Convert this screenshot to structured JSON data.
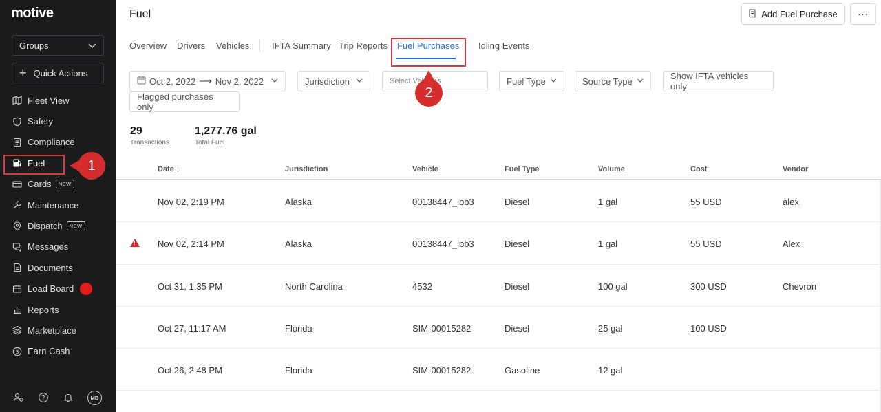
{
  "sidebar": {
    "logo": "motive",
    "groups_label": "Groups",
    "quick_actions_label": "Quick Actions",
    "items": [
      {
        "label": "Fleet View",
        "icon": "map-icon"
      },
      {
        "label": "Safety",
        "icon": "shield-icon"
      },
      {
        "label": "Compliance",
        "icon": "clipboard-icon"
      },
      {
        "label": "Fuel",
        "icon": "fuel-pump-icon"
      },
      {
        "label": "Cards",
        "icon": "card-icon",
        "badge": "NEW"
      },
      {
        "label": "Maintenance",
        "icon": "wrench-icon"
      },
      {
        "label": "Dispatch",
        "icon": "location-pin-icon",
        "badge": "NEW"
      },
      {
        "label": "Messages",
        "icon": "chat-icon"
      },
      {
        "label": "Documents",
        "icon": "document-icon"
      },
      {
        "label": "Load Board",
        "icon": "load-board-icon"
      },
      {
        "label": "Reports",
        "icon": "bar-chart-icon"
      },
      {
        "label": "Marketplace",
        "icon": "layers-icon"
      },
      {
        "label": "Earn Cash",
        "icon": "dollar-icon"
      }
    ],
    "footer": {
      "avatar_initials": "MB"
    }
  },
  "annotations": {
    "callout_1": "1",
    "callout_2": "2"
  },
  "header": {
    "title": "Fuel",
    "add_button": "Add Fuel Purchase",
    "more_button": "···"
  },
  "tabs": [
    "Overview",
    "Drivers",
    "Vehicles",
    "IFTA Summary",
    "Trip Reports",
    "Fuel Purchases",
    "Idling Events"
  ],
  "filters": {
    "date_start": "Oct 2, 2022",
    "date_arrow": "⟶",
    "date_end": "Nov 2, 2022",
    "jurisdiction": "Jurisdiction",
    "vehicles_placeholder": "Select Vehicles",
    "fuel_type": "Fuel Type",
    "source_type": "Source Type",
    "ifta_only": "Show IFTA vehicles only",
    "flagged_only": "Flagged purchases only"
  },
  "stats": {
    "transactions_value": "29",
    "transactions_label": "Transactions",
    "fuel_value": "1,277.76 gal",
    "fuel_label": "Total Fuel"
  },
  "table": {
    "columns": [
      "Date ↓",
      "Jurisdiction",
      "Vehicle",
      "Fuel Type",
      "Volume",
      "Cost",
      "Vendor"
    ],
    "rows": [
      {
        "flag": false,
        "date": "Nov 02, 2:19 PM",
        "jurisdiction": "Alaska",
        "vehicle": "00138447_lbb3",
        "fuel_type": "Diesel",
        "volume": "1 gal",
        "cost": "55 USD",
        "vendor": "alex"
      },
      {
        "flag": true,
        "date": "Nov 02, 2:14 PM",
        "jurisdiction": "Alaska",
        "vehicle": "00138447_lbb3",
        "fuel_type": "Diesel",
        "volume": "1 gal",
        "cost": "55 USD",
        "vendor": "Alex"
      },
      {
        "flag": false,
        "date": "Oct 31, 1:35 PM",
        "jurisdiction": "North Carolina",
        "vehicle": "4532",
        "fuel_type": "Diesel",
        "volume": "100 gal",
        "cost": "300 USD",
        "vendor": "Chevron"
      },
      {
        "flag": false,
        "date": "Oct 27, 11:17 AM",
        "jurisdiction": "Florida",
        "vehicle": "SIM-00015282",
        "fuel_type": "Diesel",
        "volume": "25 gal",
        "cost": "100 USD",
        "vendor": ""
      },
      {
        "flag": false,
        "date": "Oct 26, 2:48 PM",
        "jurisdiction": "Florida",
        "vehicle": "SIM-00015282",
        "fuel_type": "Gasoline",
        "volume": "12 gal",
        "cost": "",
        "vendor": ""
      }
    ]
  }
}
